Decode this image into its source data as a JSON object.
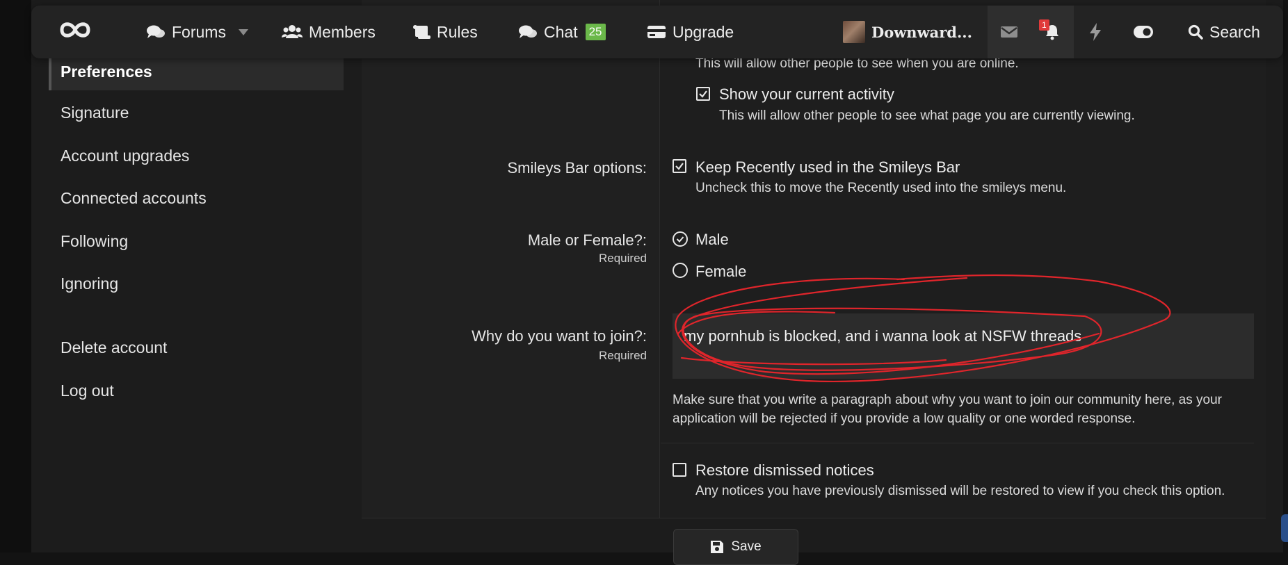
{
  "nav": {
    "forums": "Forums",
    "members": "Members",
    "rules": "Rules",
    "chat": "Chat",
    "chat_count": "25",
    "upgrade": "Upgrade",
    "username": "Downward...",
    "alerts_count": "1",
    "search": "Search"
  },
  "sidebar": {
    "items": [
      {
        "label": "Preferences",
        "active": true
      },
      {
        "label": "Signature"
      },
      {
        "label": "Account upgrades"
      },
      {
        "label": "Connected accounts"
      },
      {
        "label": "Following"
      },
      {
        "label": "Ignoring"
      },
      {
        "label": "Delete account"
      },
      {
        "label": "Log out"
      }
    ]
  },
  "form": {
    "online_hint": "This will allow other people to see when you are online.",
    "activity_label": "Show your current activity",
    "activity_checked": true,
    "activity_hint": "This will allow other people to see what page you are currently viewing.",
    "smileys_label": "Smileys Bar options:",
    "smileys_option": "Keep Recently used in the Smileys Bar",
    "smileys_checked": true,
    "smileys_hint": "Uncheck this to move the Recently used into the smileys menu.",
    "gender_label": "Male or Female?:",
    "gender_required": "Required",
    "gender_options": [
      "Male",
      "Female"
    ],
    "gender_selected": "Male",
    "why_label": "Why do you want to join?:",
    "why_required": "Required",
    "why_value": "my pornhub is blocked, and i wanna look at NSFW threads",
    "why_hint_line1": "Make sure that you write a paragraph about why you want to join our community here, as your",
    "why_hint_line2": "application will be rejected if you provide a low quality or one worded response.",
    "restore_label": "Restore dismissed notices",
    "restore_checked": false,
    "restore_hint": "Any notices you have previously dismissed will be restored to view if you check this option.",
    "save": "Save"
  },
  "colors": {
    "chat_badge": "#6bb84a",
    "alert_badge": "#e03a3a",
    "annotation": "#e0252b"
  }
}
